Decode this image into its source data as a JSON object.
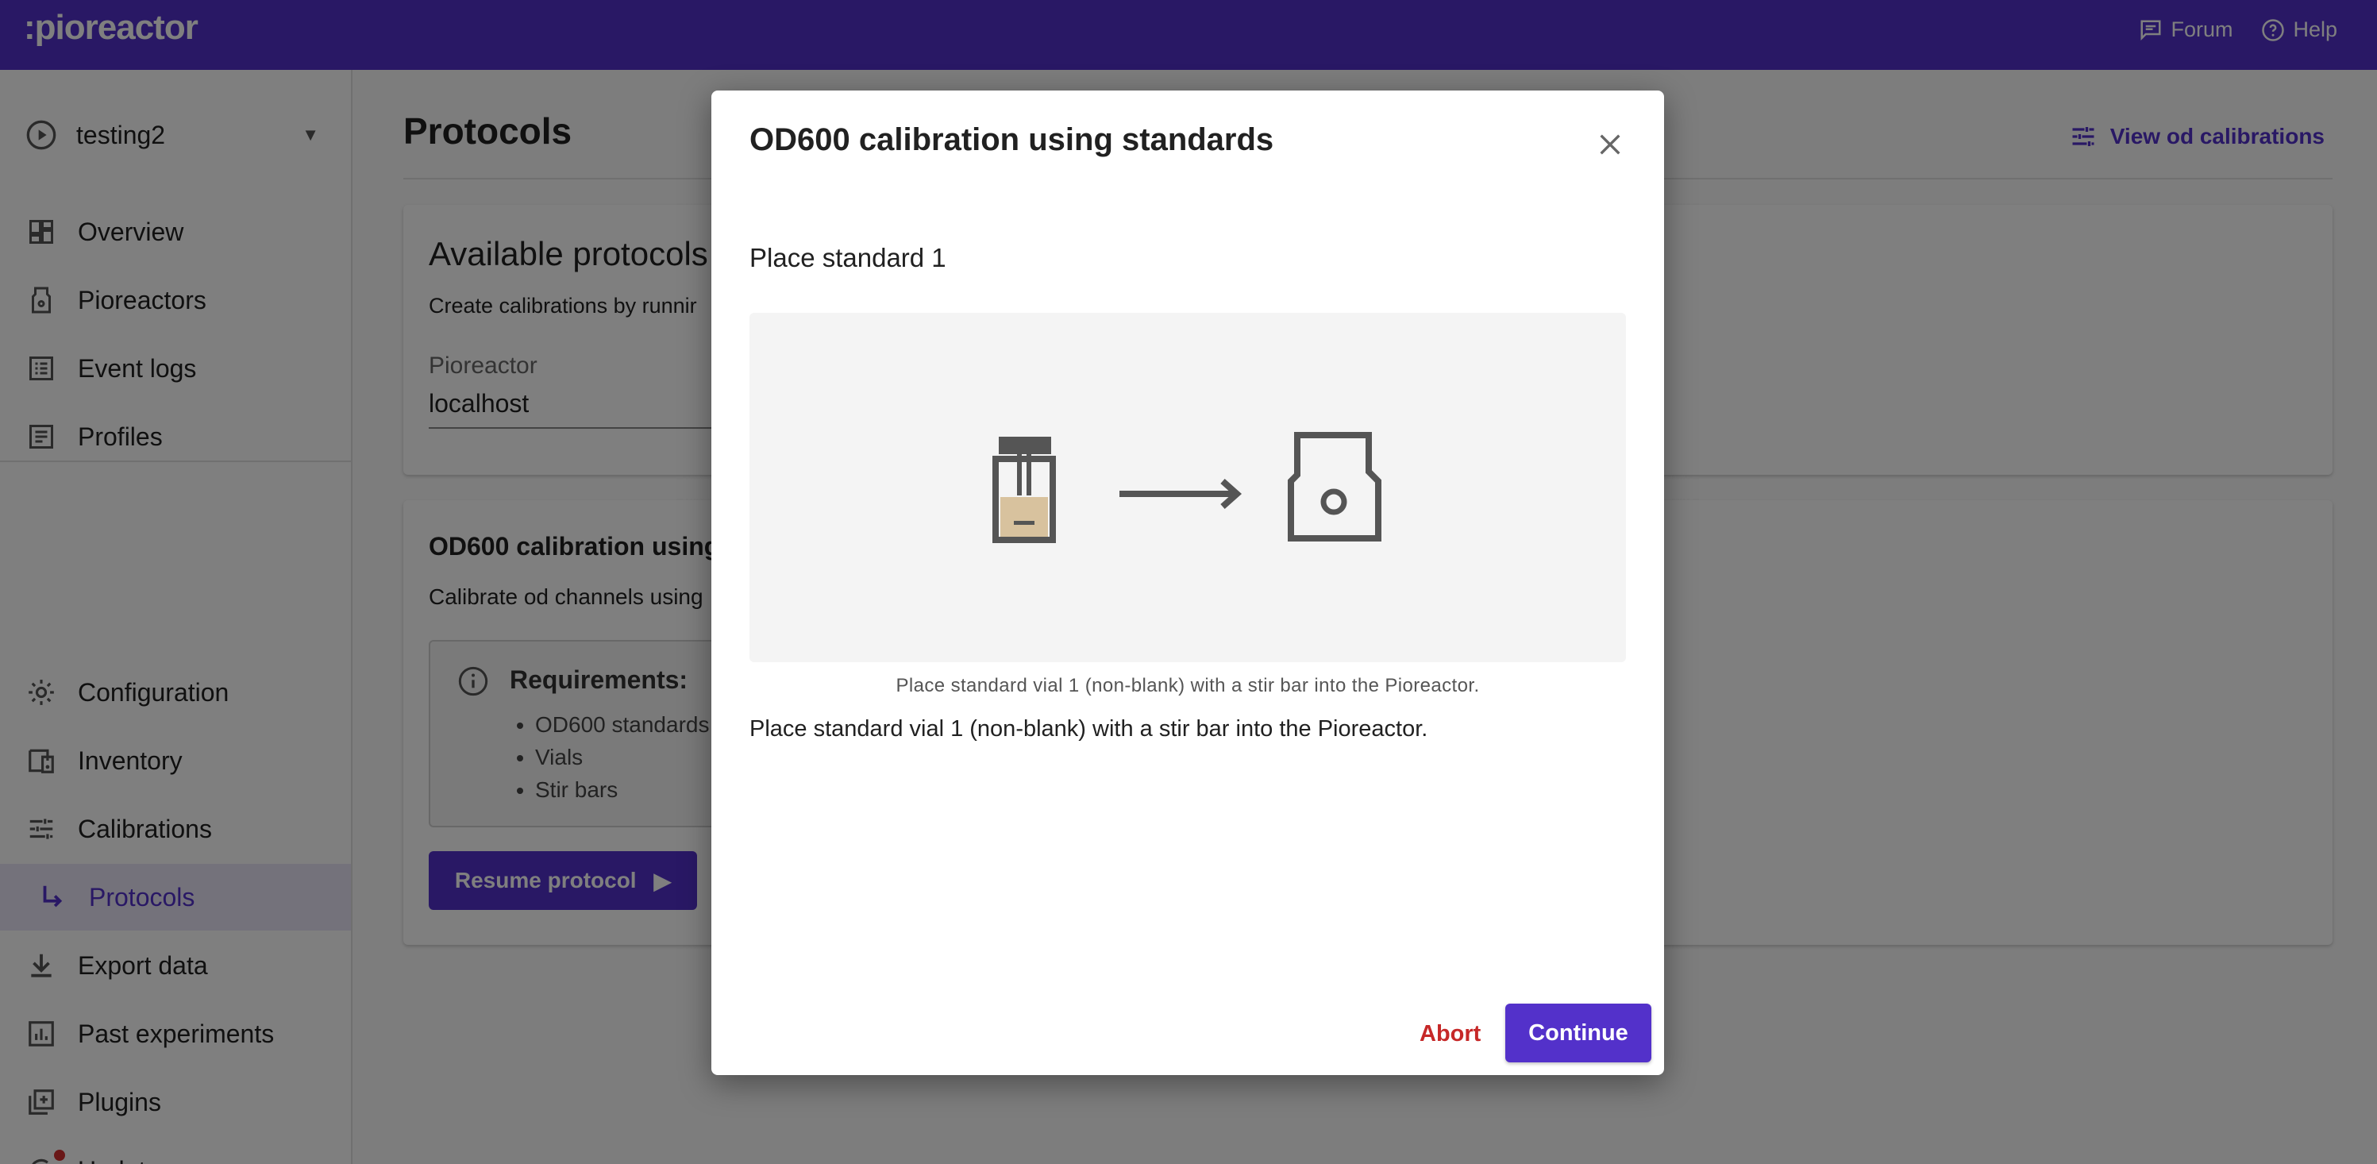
{
  "app": {
    "logo": ":pioreactor"
  },
  "topbar": {
    "links": [
      {
        "label": "Forum",
        "icon": "forum-icon"
      },
      {
        "label": "Help",
        "icon": "help-icon"
      }
    ]
  },
  "sidebar": {
    "experiment": "testing2",
    "items_top": [
      {
        "label": "Overview",
        "icon": "dashboard-icon"
      },
      {
        "label": "Pioreactors",
        "icon": "pioreactor-icon"
      },
      {
        "label": "Event logs",
        "icon": "list-icon"
      },
      {
        "label": "Profiles",
        "icon": "profile-icon"
      }
    ],
    "items_bottom": [
      {
        "label": "Configuration",
        "icon": "gear-icon"
      },
      {
        "label": "Inventory",
        "icon": "inventory-icon"
      },
      {
        "label": "Calibrations",
        "icon": "tune-icon"
      },
      {
        "label": "Protocols",
        "icon": "subdirectory-arrow-icon",
        "active": true
      },
      {
        "label": "Export data",
        "icon": "download-icon"
      },
      {
        "label": "Past experiments",
        "icon": "chart-icon"
      },
      {
        "label": "Plugins",
        "icon": "plugin-icon"
      },
      {
        "label": "Updates",
        "icon": "update-icon",
        "badge": true
      }
    ]
  },
  "main": {
    "title": "Protocols",
    "view_calibrations": "View od calibrations",
    "available": {
      "heading": "Available protocols",
      "subtitle": "Create calibrations by runnir",
      "pioreactor_label": "Pioreactor",
      "pioreactor_value": "localhost"
    },
    "protocol": {
      "heading": "OD600 calibration using",
      "subtitle": "Calibrate od channels using",
      "requirements_title": "Requirements:",
      "requirements": [
        "OD600 standards",
        "Vials",
        "Stir bars"
      ],
      "resume_label": "Resume protocol"
    }
  },
  "dialog": {
    "title": "OD600 calibration using standards",
    "step_title": "Place standard 1",
    "caption": "Place standard vial 1 (non-blank) with a stir bar into the Pioreactor.",
    "body": "Place standard vial 1 (non-blank) with a stir bar into the Pioreactor.",
    "abort_label": "Abort",
    "continue_label": "Continue"
  },
  "colors": {
    "brand": "#5331ca",
    "abort": "#c62828",
    "active_bg": "#e8e4f6"
  }
}
